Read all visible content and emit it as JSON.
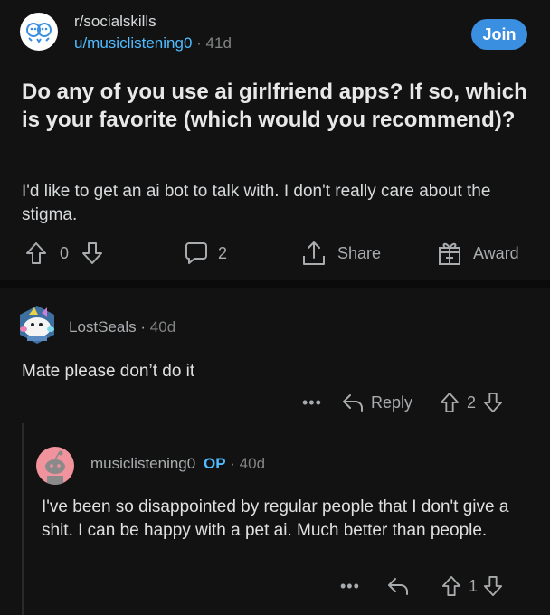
{
  "post": {
    "subreddit": "r/socialskills",
    "author": "u/musiclistening0",
    "age": "41d",
    "join_label": "Join",
    "title": "Do any of you use ai girlfriend apps? If so, which is your favorite (which would you recommend)?",
    "body": "I'd like to get an ai bot to talk with. I don't really care about the stigma.",
    "votes": "0",
    "comment_count": "2",
    "share_label": "Share",
    "award_label": "Award"
  },
  "comment": {
    "author": "LostSeals",
    "age": "40d",
    "text": "Mate please don’t do it",
    "reply_label": "Reply",
    "votes": "2",
    "more": "•••"
  },
  "reply": {
    "author": "musiclistening0",
    "op_badge": "OP",
    "age": "40d",
    "text": "I've been so disappointed by regular people that I don't give a shit. I can be happy with a pet ai. Much better than people.",
    "votes": "1",
    "more": "•••"
  },
  "theme": {
    "background": "#0b0b0b",
    "card": "#121212",
    "accent": "#3b8fe0",
    "link": "#4fbcff",
    "text": "#d7dadc",
    "muted": "#818384"
  }
}
